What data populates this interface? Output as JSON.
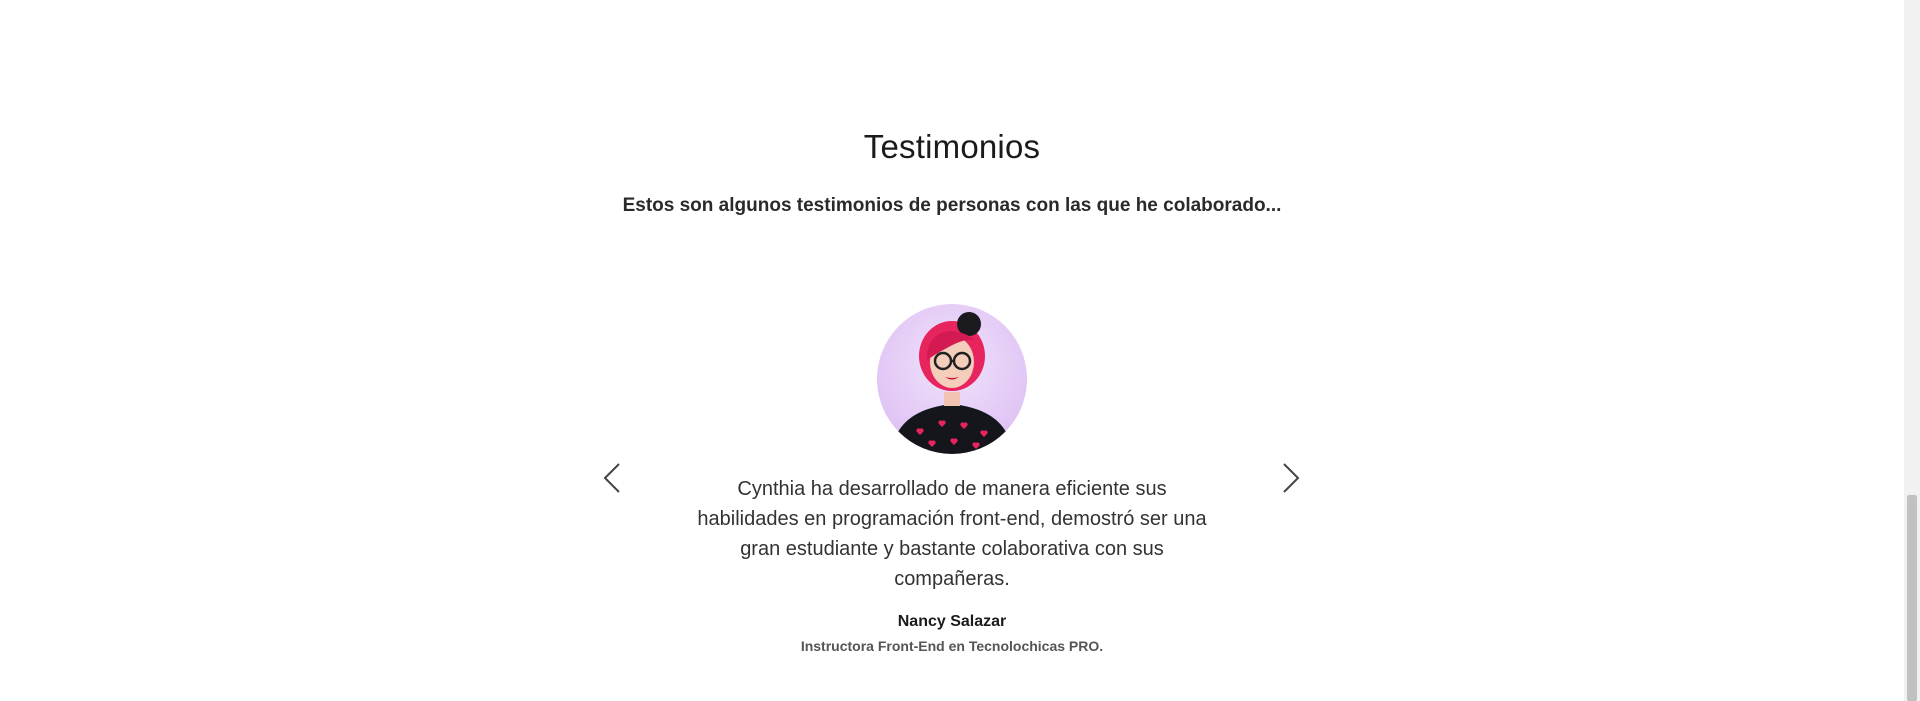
{
  "testimonials": {
    "title": "Testimonios",
    "subtitle": "Estos son algunos testimonios de personas con las que he colaborado...",
    "current": {
      "quote": "Cynthia ha desarrollado de manera eficiente sus habilidades en programación front-end, demostró ser una gran estudiante y bastante colaborativa con sus compañeras.",
      "author_name": "Nancy Salazar",
      "author_role": "Instructora Front-End en Tecnolochicas PRO."
    },
    "prev_icon": "chevron-left-icon",
    "next_icon": "chevron-right-icon"
  },
  "colors": {
    "background": "#ffffff",
    "text": "#1b1b1b",
    "avatar_bg": "#e4cbf6",
    "hair": "#e8245e"
  }
}
